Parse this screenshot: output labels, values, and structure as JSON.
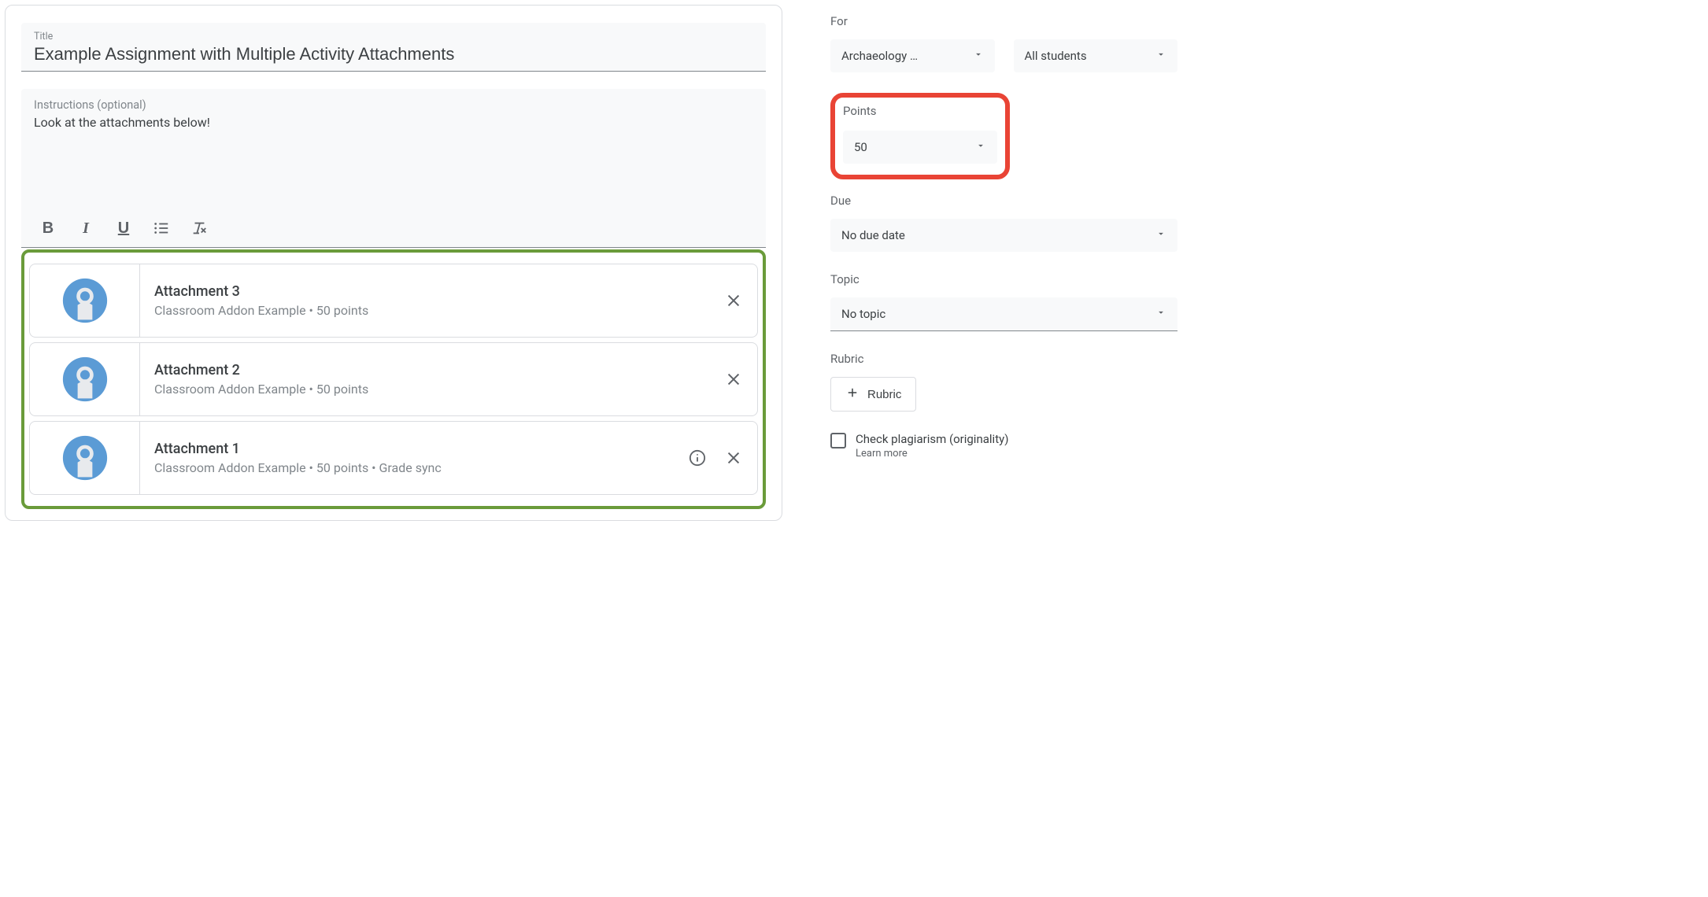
{
  "title_field": {
    "label": "Title",
    "value": "Example Assignment with Multiple Activity Attachments"
  },
  "instructions_field": {
    "label": "Instructions (optional)",
    "value": "Look at the attachments below!"
  },
  "attachments": [
    {
      "title": "Attachment 3",
      "subtitle": "Classroom Addon Example • 50 points",
      "has_info": false
    },
    {
      "title": "Attachment 2",
      "subtitle": "Classroom Addon Example • 50 points",
      "has_info": false
    },
    {
      "title": "Attachment 1",
      "subtitle": "Classroom Addon Example • 50 points • Grade sync",
      "has_info": true
    }
  ],
  "sidebar": {
    "for_label": "For",
    "class_select": "Archaeology …",
    "students_select": "All students",
    "points_label": "Points",
    "points_value": "50",
    "due_label": "Due",
    "due_value": "No due date",
    "topic_label": "Topic",
    "topic_value": "No topic",
    "rubric_label": "Rubric",
    "rubric_button": "Rubric",
    "plagiarism_label": "Check plagiarism (originality)",
    "learn_more": "Learn more"
  }
}
